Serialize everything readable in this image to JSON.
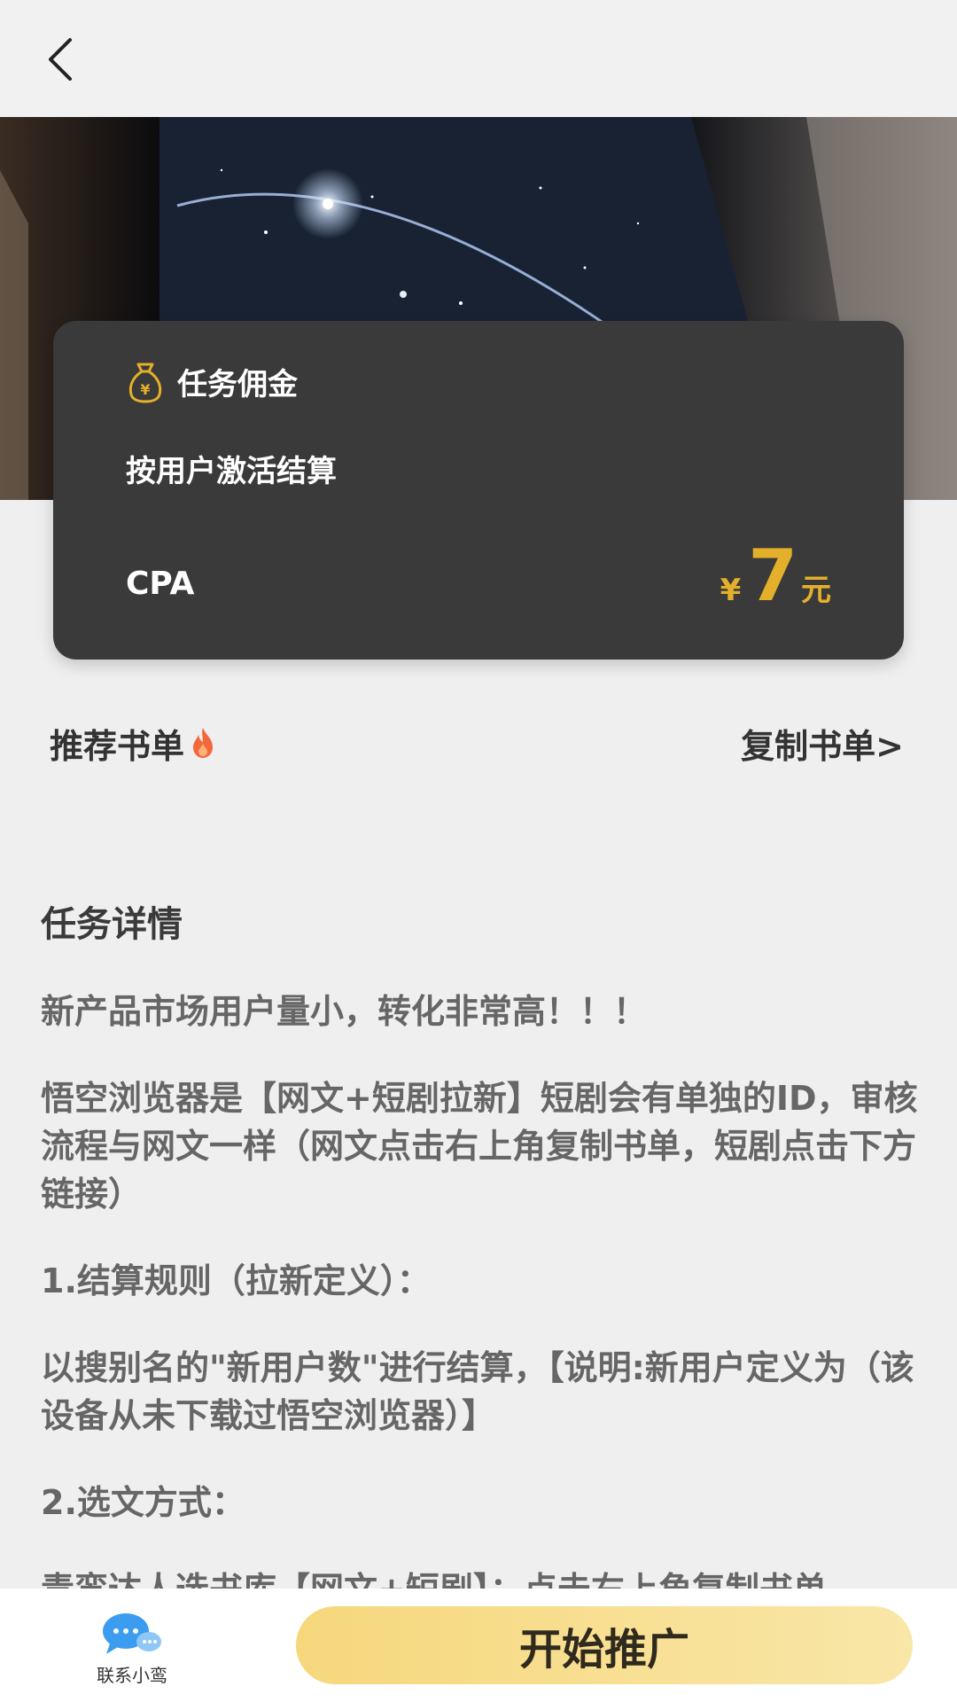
{
  "header": {
    "back_icon": "chevron-left-icon"
  },
  "card": {
    "icon": "money-bag-icon",
    "title": "任务佣金",
    "subtitle": "按用户激活结算",
    "cpa": "CPA",
    "currency": "¥",
    "amount": "7",
    "unit": "元",
    "accent_color": "#e4b02b"
  },
  "section": {
    "recommend_label": "推荐书单",
    "recommend_icon": "fire-icon",
    "copy_label": "复制书单>"
  },
  "detail": {
    "heading": "任务详情",
    "p1": "新产品市场用户量小，转化非常高！！！",
    "p2": "悟空浏览器是【网文+短剧拉新】短剧会有单独的ID，审核流程与网文一样（网文点击右上角复制书单，短剧点击下方链接）",
    "p3": "1.结算规则（拉新定义）：",
    "p4": "以搜别名的\"新用户数\"进行结算，【说明:新用户定义为（该设备从未下载过悟空浏览器）】",
    "p5": "2.选文方式：",
    "p6": "青鸾达人选书库【网文+短剧】：点击右上角复制书单"
  },
  "footer": {
    "contact_icon": "chat-bubbles-icon",
    "contact_label": "联系小鸾",
    "start_button": "开始推广",
    "button_color": "#f6d77c"
  }
}
